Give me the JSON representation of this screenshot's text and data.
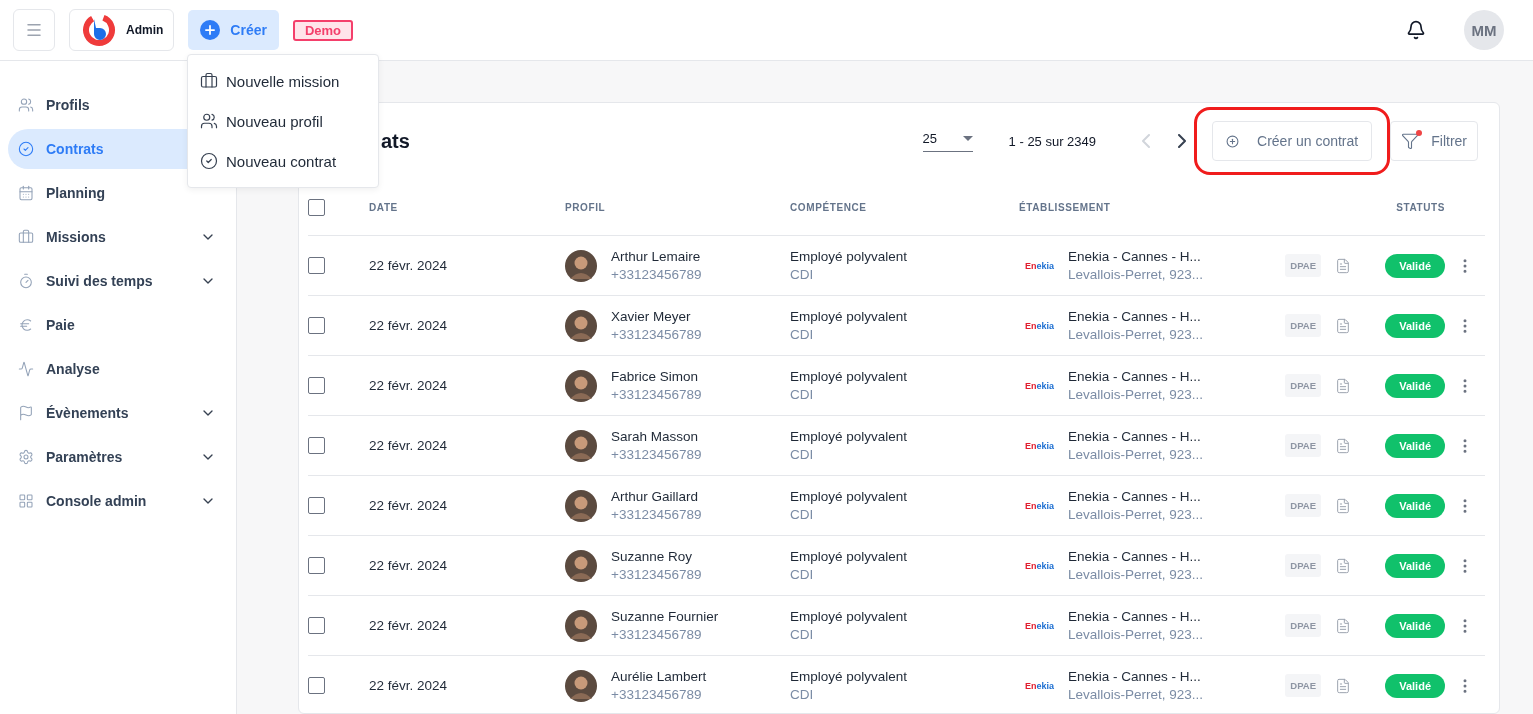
{
  "header": {
    "brand": "Admin",
    "create_button": "Créer",
    "env_badge": "Demo",
    "avatar_initials": "MM"
  },
  "create_menu": [
    {
      "label": "Nouvelle mission"
    },
    {
      "label": "Nouveau profil"
    },
    {
      "label": "Nouveau contrat"
    }
  ],
  "sidebar": {
    "items": [
      {
        "label": "Profils",
        "kind": "link",
        "selected": false
      },
      {
        "label": "Contrats",
        "kind": "link",
        "selected": true
      },
      {
        "label": "Planning",
        "kind": "link",
        "selected": false
      },
      {
        "label": "Missions",
        "kind": "group",
        "selected": false
      },
      {
        "label": "Suivi des temps",
        "kind": "group",
        "selected": false
      },
      {
        "label": "Paie",
        "kind": "link",
        "selected": false
      },
      {
        "label": "Analyse",
        "kind": "link",
        "selected": false
      },
      {
        "label": "Évènements",
        "kind": "group",
        "selected": false
      },
      {
        "label": "Paramètres",
        "kind": "group",
        "selected": false
      },
      {
        "label": "Console admin",
        "kind": "group",
        "selected": false
      }
    ]
  },
  "card": {
    "title_visible_part": "ats",
    "page_size": "25",
    "range": "1 - 25 sur 2349",
    "prev_disabled": true,
    "next_disabled": false,
    "create_button": {
      "label": "Créer un contrat",
      "highlighted": true
    },
    "filter_button": {
      "label": "Filtrer",
      "active": true
    }
  },
  "table": {
    "select_all_checked": false,
    "columns": [
      "DATE",
      "PROFIL",
      "COMPÉTENCE",
      "ÉTABLISSEMENT",
      "STATUTS"
    ],
    "rows": [
      {
        "checked": false,
        "date": "22 févr. 2024",
        "name": "Arthur Lemaire",
        "phone": "+33123456789",
        "skill": "Employé polyvalent",
        "contract": "CDI",
        "logo": "Enekia",
        "site": "Enekia - Cannes - H...",
        "address": "Levallois-Perret, 923...",
        "dpae": "DPAE",
        "status": "Validé"
      },
      {
        "checked": false,
        "date": "22 févr. 2024",
        "name": "Xavier Meyer",
        "phone": "+33123456789",
        "skill": "Employé polyvalent",
        "contract": "CDI",
        "logo": "Enekia",
        "site": "Enekia - Cannes - H...",
        "address": "Levallois-Perret, 923...",
        "dpae": "DPAE",
        "status": "Validé"
      },
      {
        "checked": false,
        "date": "22 févr. 2024",
        "name": "Fabrice Simon",
        "phone": "+33123456789",
        "skill": "Employé polyvalent",
        "contract": "CDI",
        "logo": "Enekia",
        "site": "Enekia - Cannes - H...",
        "address": "Levallois-Perret, 923...",
        "dpae": "DPAE",
        "status": "Validé"
      },
      {
        "checked": false,
        "date": "22 févr. 2024",
        "name": "Sarah Masson",
        "phone": "+33123456789",
        "skill": "Employé polyvalent",
        "contract": "CDI",
        "logo": "Enekia",
        "site": "Enekia - Cannes - H...",
        "address": "Levallois-Perret, 923...",
        "dpae": "DPAE",
        "status": "Validé"
      },
      {
        "checked": false,
        "date": "22 févr. 2024",
        "name": "Arthur Gaillard",
        "phone": "+33123456789",
        "skill": "Employé polyvalent",
        "contract": "CDI",
        "logo": "Enekia",
        "site": "Enekia - Cannes - H...",
        "address": "Levallois-Perret, 923...",
        "dpae": "DPAE",
        "status": "Validé"
      },
      {
        "checked": false,
        "date": "22 févr. 2024",
        "name": "Suzanne Roy",
        "phone": "+33123456789",
        "skill": "Employé polyvalent",
        "contract": "CDI",
        "logo": "Enekia",
        "site": "Enekia - Cannes - H...",
        "address": "Levallois-Perret, 923...",
        "dpae": "DPAE",
        "status": "Validé"
      },
      {
        "checked": false,
        "date": "22 févr. 2024",
        "name": "Suzanne Fournier",
        "phone": "+33123456789",
        "skill": "Employé polyvalent",
        "contract": "CDI",
        "logo": "Enekia",
        "site": "Enekia - Cannes - H...",
        "address": "Levallois-Perret, 923...",
        "dpae": "DPAE",
        "status": "Validé"
      },
      {
        "checked": false,
        "date": "22 févr. 2024",
        "name": "Aurélie Lambert",
        "phone": "+33123456789",
        "skill": "Employé polyvalent",
        "contract": "CDI",
        "logo": "Enekia",
        "site": "Enekia - Cannes - H...",
        "address": "Levallois-Perret, 923...",
        "dpae": "DPAE",
        "status": "Validé"
      }
    ]
  }
}
